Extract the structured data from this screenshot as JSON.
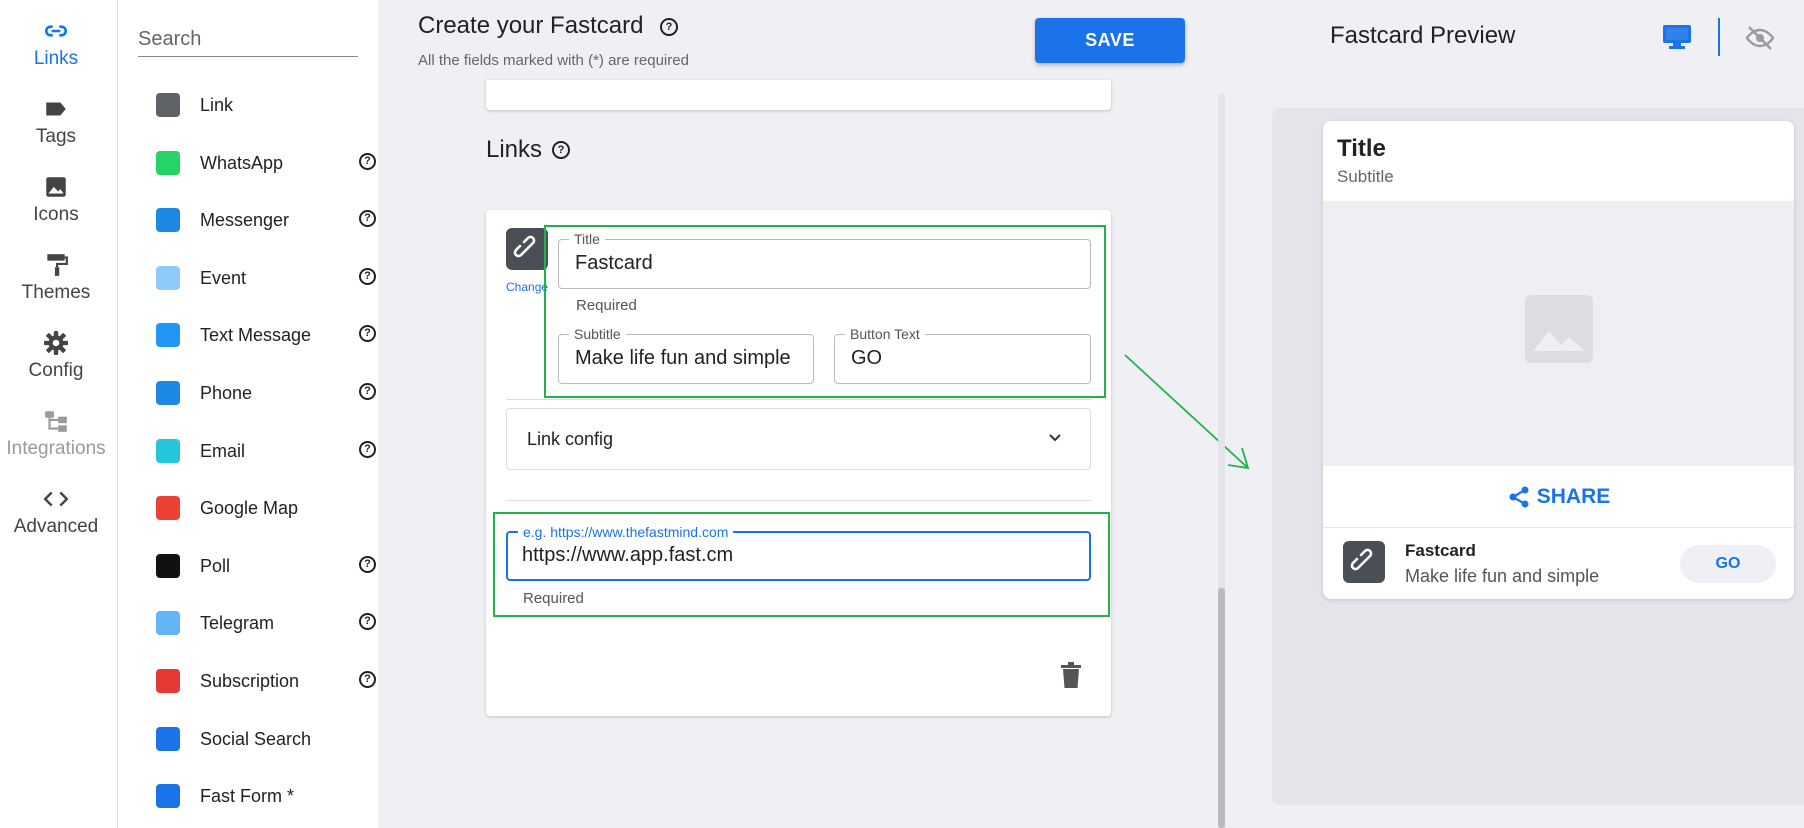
{
  "rail": {
    "items": [
      {
        "label": "Links",
        "icon": "link-icon"
      },
      {
        "label": "Tags",
        "icon": "tag-icon"
      },
      {
        "label": "Icons",
        "icon": "image-icon"
      },
      {
        "label": "Themes",
        "icon": "paint-roller-icon"
      },
      {
        "label": "Config",
        "icon": "gear-icon"
      },
      {
        "label": "Integrations",
        "icon": "integrations-icon"
      },
      {
        "label": "Advanced",
        "icon": "code-icon"
      }
    ]
  },
  "menu": {
    "search_placeholder": "Search",
    "items": [
      {
        "label": "Link",
        "icon": "link-icon",
        "color": "#5f6368",
        "help": false
      },
      {
        "label": "WhatsApp",
        "icon": "whatsapp-icon",
        "color": "#25d366",
        "help": true
      },
      {
        "label": "Messenger",
        "icon": "messenger-icon",
        "color": "#1e88e5",
        "help": true
      },
      {
        "label": "Event",
        "icon": "calendar-icon",
        "color": "#90caf9",
        "help": true
      },
      {
        "label": "Text Message",
        "icon": "sms-icon",
        "color": "#2196f3",
        "help": true
      },
      {
        "label": "Phone",
        "icon": "phone-icon",
        "color": "#1e88e5",
        "help": true
      },
      {
        "label": "Email",
        "icon": "email-icon",
        "color": "#26c6da",
        "help": true
      },
      {
        "label": "Google Map",
        "icon": "map-pin-icon",
        "color": "#ea4335",
        "help": false
      },
      {
        "label": "Poll",
        "icon": "poll-icon",
        "color": "#111111",
        "help": true
      },
      {
        "label": "Telegram",
        "icon": "telegram-icon",
        "color": "#64b5f6",
        "help": true
      },
      {
        "label": "Subscription",
        "icon": "youtube-icon",
        "color": "#e53935",
        "help": true
      },
      {
        "label": "Social Search",
        "icon": "social-search-icon",
        "color": "#1a73e8",
        "help": false
      },
      {
        "label": "Fast Form *",
        "icon": "form-icon",
        "color": "#1a73e8",
        "help": false
      }
    ]
  },
  "header": {
    "title": "Create your Fastcard",
    "subtitle": "All the fields marked with (*) are required",
    "save_label": "SAVE",
    "help_glyph": "?"
  },
  "editor": {
    "section_title": "Links",
    "change_label": "Change",
    "title_field": {
      "label": "Title",
      "value": "Fastcard",
      "helper": "Required"
    },
    "subtitle_field": {
      "label": "Subtitle",
      "value": "Make life fun and simple"
    },
    "button_field": {
      "label": "Button Text",
      "value": "GO"
    },
    "link_config_label": "Link config",
    "url_field": {
      "label": "e.g. https://www.thefastmind.com",
      "value": "https://www.app.fast.cm",
      "helper": "Required"
    }
  },
  "preview": {
    "title": "Fastcard Preview",
    "card_title": "Title",
    "card_subtitle": "Subtitle",
    "share_label": "SHARE",
    "link_title": "Fastcard",
    "link_subtitle": "Make life fun and simple",
    "go_label": "GO"
  },
  "colors": {
    "accent": "#1a73e8",
    "annotation": "#22b24c"
  }
}
